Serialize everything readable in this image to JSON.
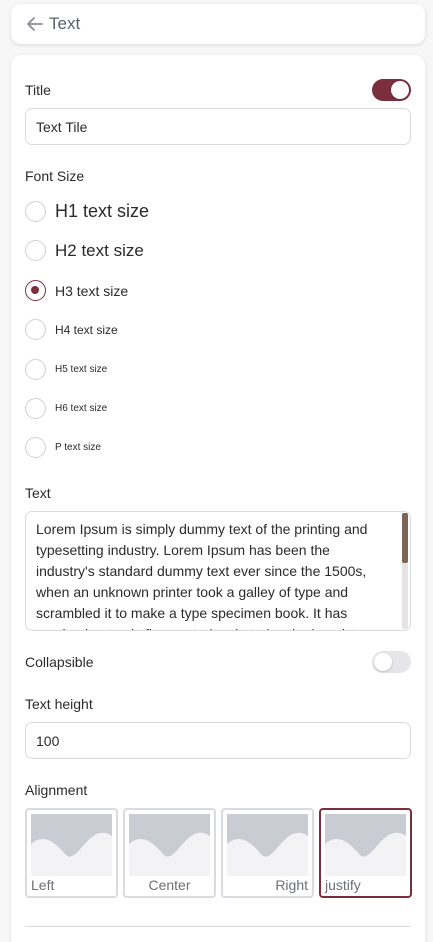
{
  "header": {
    "back_icon": "arrow-left-icon",
    "title": "Text"
  },
  "title_section": {
    "label": "Title",
    "toggle_on": true,
    "input_value": "Text Tile"
  },
  "font_size": {
    "label": "Font Size",
    "options": [
      {
        "label": "H1 text size",
        "checked": false
      },
      {
        "label": "H2 text size",
        "checked": false
      },
      {
        "label": "H3 text size",
        "checked": true
      },
      {
        "label": "H4 text size",
        "checked": false
      },
      {
        "label": "H5 text size",
        "checked": false
      },
      {
        "label": "H6 text size",
        "checked": false
      },
      {
        "label": "P text size",
        "checked": false
      }
    ]
  },
  "text_section": {
    "label": "Text",
    "value": "Lorem Ipsum is simply dummy text of the printing and typesetting industry. Lorem Ipsum has been the industry's standard dummy text ever since the 1500s, when an unknown printer took a galley of type and scrambled it to make a type specimen book. It has survived not only five centuries, but also the leap into electronic typesetting, remaining essentially unchanged."
  },
  "collapsible": {
    "label": "Collapsible",
    "toggle_on": false
  },
  "text_height": {
    "label": "Text height",
    "value": "100"
  },
  "alignment": {
    "label": "Alignment",
    "options": [
      {
        "label": "Left",
        "selected": false
      },
      {
        "label": "Center",
        "selected": false
      },
      {
        "label": "Right",
        "selected": false
      },
      {
        "label": "justify",
        "selected": true
      }
    ]
  },
  "colors": {
    "accent": "#7a2e3e",
    "border": "#dadbe0"
  }
}
